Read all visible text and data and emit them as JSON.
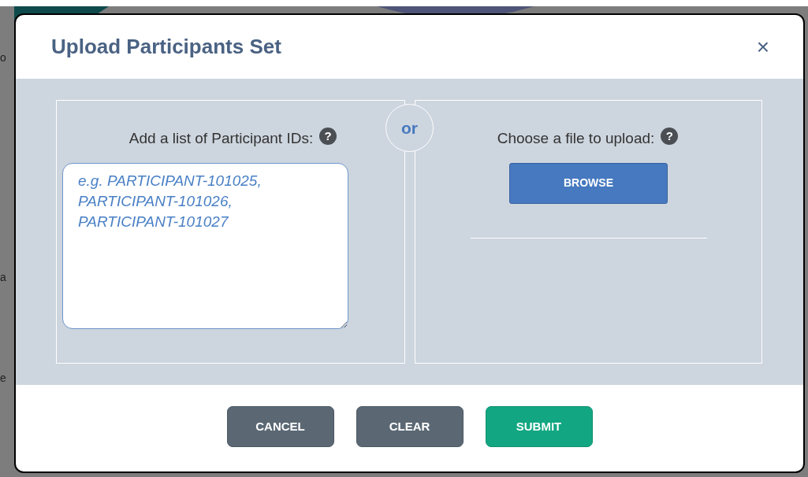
{
  "backdrop": {
    "fragments": [
      "o",
      "a",
      "e"
    ]
  },
  "dialog": {
    "title": "Upload Participants Set",
    "close": "×",
    "left": {
      "label": "Add a list of Participant IDs:",
      "help": "?",
      "placeholder": "e.g. PARTICIPANT-101025, PARTICIPANT-101026, PARTICIPANT-101027"
    },
    "divider": "or",
    "right": {
      "label": "Choose a file to upload:",
      "help": "?",
      "button": "BROWSE"
    },
    "buttons": [
      {
        "label": "CANCEL",
        "kind": "secondary"
      },
      {
        "label": "CLEAR",
        "kind": "secondary"
      },
      {
        "label": "SUBMIT",
        "kind": "primary"
      }
    ]
  }
}
